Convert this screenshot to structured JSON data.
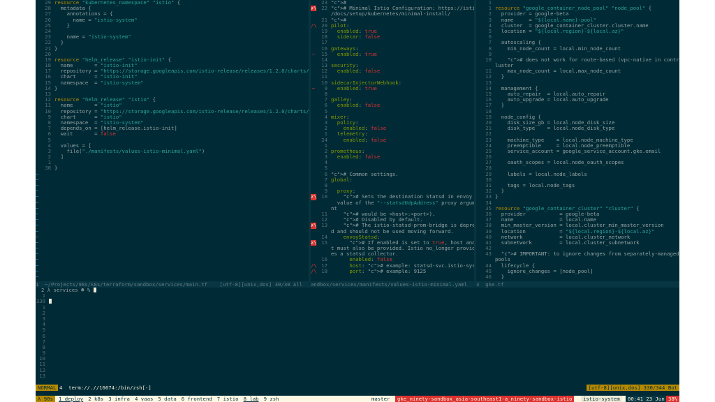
{
  "colors": {
    "background": "#002b36",
    "string": "#2aa198",
    "keyword": "#b58900",
    "comment": "#657b83",
    "accent": "#dc322f"
  },
  "left_pane": {
    "lines": [
      [
        "29",
        "resource \"kubernetes_namespace\" \"istio\" {"
      ],
      [
        "28",
        "  metadata {"
      ],
      [
        "27",
        "    annotations = {"
      ],
      [
        "26",
        "      name = \"istio-system\""
      ],
      [
        "25",
        "    }"
      ],
      [
        "24",
        ""
      ],
      [
        "23",
        "    name = \"istio-system\""
      ],
      [
        "22",
        "  }"
      ],
      [
        "21",
        "}"
      ],
      [
        "20",
        ""
      ],
      [
        "19",
        "resource \"helm_release\" \"istio-init\" {"
      ],
      [
        "18",
        "  name       = \"istio-init\""
      ],
      [
        "17",
        "  repository = \"https://storage.googleapis.com/istio-release/releases/1.2.0/charts/\""
      ],
      [
        "16",
        "  chart      = \"istio-init\""
      ],
      [
        "15",
        "  namespace  = \"istio-system\""
      ],
      [
        "14",
        "}"
      ],
      [
        "13",
        ""
      ],
      [
        "12",
        "resource \"helm_release\" \"istio\" {"
      ],
      [
        "11",
        "  name       = \"istio\""
      ],
      [
        "10",
        "  repository = \"https://storage.googleapis.com/istio-release/releases/1.2.0/charts/\""
      ],
      [
        "9",
        "  chart      = \"istio\""
      ],
      [
        "8",
        "  namespace  = \"istio-system\""
      ],
      [
        "7",
        "  depends_on = [helm_release.istio-init]"
      ],
      [
        "6",
        "  wait       = false"
      ],
      [
        "5",
        ""
      ],
      [
        "4",
        "  values = ["
      ],
      [
        "3",
        "    file(\"./manifests/values-istio-minimal.yaml\")"
      ],
      [
        "2",
        "  ]"
      ],
      [
        "1",
        ""
      ],
      [
        "30",
        "}"
      ]
    ],
    "status": "1  ~/Projects/98s/k8s/terraform/sandbox/services/main.tf    [utf-8][unix,dos] 30/30 All"
  },
  "middle_pane": {
    "lines": [
      [
        "",
        "23",
        "#"
      ],
      [
        "E",
        "22",
        "# Minimal Istio Configuration: https://istio.io"
      ],
      [
        "",
        "",
        "/docs/setup/kubernetes/minimal-install/"
      ],
      [
        "",
        "21",
        "#"
      ],
      [
        "W",
        "20",
        "pilot:"
      ],
      [
        "",
        "19",
        "  enabled: true"
      ],
      [
        "",
        "18",
        "  sidecar: false"
      ],
      [
        "",
        "17",
        ""
      ],
      [
        "",
        "16",
        "gateways:"
      ],
      [
        "~",
        "15",
        "  enabled: true"
      ],
      [
        "",
        "14",
        ""
      ],
      [
        "",
        "13",
        "security:"
      ],
      [
        "",
        "12",
        "  enabled: false"
      ],
      [
        "",
        "11",
        ""
      ],
      [
        "",
        "10",
        "sidecarInjectorWebhook:"
      ],
      [
        "~",
        "9",
        "  enabled: true"
      ],
      [
        "",
        "8",
        ""
      ],
      [
        "",
        "7",
        "galley:"
      ],
      [
        "",
        "6",
        "  enabled: false"
      ],
      [
        "",
        "5",
        ""
      ],
      [
        "",
        "4",
        "mixer:"
      ],
      [
        "",
        "3",
        "  policy:"
      ],
      [
        "",
        "2",
        "    enabled: false"
      ],
      [
        "",
        "1",
        "  telemetry:"
      ],
      [
        "",
        "24",
        "    enabled: false"
      ],
      [
        "",
        "1",
        ""
      ],
      [
        "",
        "2",
        "prometheus:"
      ],
      [
        "",
        "3",
        "  enabled: false"
      ],
      [
        "",
        "4",
        ""
      ],
      [
        "",
        "5",
        ""
      ],
      [
        "",
        "6",
        "# Common settings."
      ],
      [
        "",
        "7",
        "global:"
      ],
      [
        "",
        "8",
        ""
      ],
      [
        "",
        "9",
        "  proxy:"
      ],
      [
        "E",
        "10",
        "    # Sets the destination Statsd in envoy (the"
      ],
      [
        "",
        "",
        "  value of the \"--statsdUdpAddress\" proxy argume"
      ],
      [
        "",
        "",
        "nt"
      ],
      [
        "",
        "11",
        "    # would be <host>:<port>)."
      ],
      [
        "",
        "12",
        "    # Disabled by default."
      ],
      [
        "E",
        "13",
        "    # The istio-statsd-prom-bridge is deprecate"
      ],
      [
        "",
        "",
        "d and should not be used moving forward."
      ],
      [
        "",
        "14",
        "    envoyStatsd:"
      ],
      [
        "E",
        "15",
        "      # If enabled is set to true, host and por"
      ],
      [
        "",
        "",
        "t must also be provided. Istio no_longer provid"
      ],
      [
        "",
        "",
        "es a statsd collector."
      ],
      [
        "",
        "16",
        "      enabled: false"
      ],
      [
        "W",
        "17",
        "      host: # example: statsd-svc.istio-system"
      ],
      [
        "W",
        "18",
        "      port: # example: 9125"
      ]
    ],
    "status": "andbox/services/manifests/values-istio-minimal.yaml"
  },
  "right_pane": {
    "lines": [
      [
        "1",
        ""
      ],
      [
        "1",
        "resource \"google_container_node_pool\" \"node_pool\" {"
      ],
      [
        "2",
        "  provider = google-beta"
      ],
      [
        "3",
        "  name     = \"${local.name}-pool\""
      ],
      [
        "4",
        "  cluster  = google_container_cluster.cluster.name"
      ],
      [
        "5",
        "  location = \"${local.region}-${local.az}\""
      ],
      [
        "6",
        ""
      ],
      [
        "7",
        "  autoscaling {"
      ],
      [
        "8",
        "    min_node_count = local.min_node_count"
      ],
      [
        "9",
        ""
      ],
      [
        "10",
        "    # does not work for route-based (vpc-native in contrast) c"
      ],
      [
        "",
        "luster"
      ],
      [
        "11",
        "    max_node_count = local.max_node_count"
      ],
      [
        "12",
        "  }"
      ],
      [
        "13",
        ""
      ],
      [
        "14",
        "  management {"
      ],
      [
        "15",
        "    auto_repair  = local.auto_repair"
      ],
      [
        "16",
        "    auto_upgrade = local.auto_upgrade"
      ],
      [
        "17",
        "  }"
      ],
      [
        "18",
        ""
      ],
      [
        "19",
        "  node_config {"
      ],
      [
        "20",
        "    disk_size_gb = local.node_disk_size"
      ],
      [
        "21",
        "    disk_type    = local.node_disk_type"
      ],
      [
        "22",
        ""
      ],
      [
        "23",
        "    machine_type    = local.node_machine_type"
      ],
      [
        "24",
        "    preemptible     = local.node_preemptible"
      ],
      [
        "25",
        "    service_account = google_service_account.gke.email"
      ],
      [
        "26",
        ""
      ],
      [
        "27",
        "    oauth_scopes = local.node_oauth_scopes"
      ],
      [
        "28",
        ""
      ],
      [
        "29",
        "    labels = local.node_labels"
      ],
      [
        "30",
        ""
      ],
      [
        "31",
        "    tags = local.node_tags"
      ],
      [
        "32",
        "  }"
      ],
      [
        "33",
        "}"
      ],
      [
        "34",
        ""
      ],
      [
        "35",
        "resource \"google_container_cluster\" \"cluster\" {"
      ],
      [
        "36",
        "  provider           = google-beta"
      ],
      [
        "37",
        "  name               = local.name"
      ],
      [
        "38",
        "  min_master_version = local.cluster_min_master_version"
      ],
      [
        "39",
        "  location           = \"${local.region}-${local.az}\""
      ],
      [
        "40",
        "  network            = local.cluster_network"
      ],
      [
        "41",
        "  subnetwork         = local.cluster_subnetwork"
      ],
      [
        "42",
        ""
      ],
      [
        "43",
        "  # IMPORTANT: to ignore changes from separately-managed node"
      ],
      [
        "",
        "pools"
      ],
      [
        "44",
        "  lifecycle {"
      ],
      [
        "45",
        "    ignore_changes = [node_pool]"
      ],
      [
        "46",
        "  }"
      ]
    ],
    "status": "3  gke.tf"
  },
  "terminal": {
    "prompt_line": "2 λ services ☻ %",
    "numbers": [
      "1",
      "330",
      "1",
      "2",
      "3",
      "4",
      "5",
      "6",
      "7",
      "8",
      "9",
      "10",
      "11",
      "12",
      "13"
    ]
  },
  "modeline": {
    "mode": "NORMAL",
    "title": "4  term://.//16674:/bin/zsh[-]",
    "right": "[utf-8][unix,dos] 330/344 Bot"
  },
  "tmux": {
    "session": "λ 90s",
    "windows": [
      "1 deploy",
      "2 k8s",
      "3 infra",
      "4 vaas",
      "5 data",
      "6 frontend",
      "7 istio",
      "8 lab",
      "9 zsh"
    ],
    "branch": "master",
    "context": "gke_ninety-sandbox_asia-southeast1-a_ninety-sandbox-istio",
    "namespace": "istio-system",
    "clock": "00:41 23 Jun",
    "battery": "38%"
  }
}
